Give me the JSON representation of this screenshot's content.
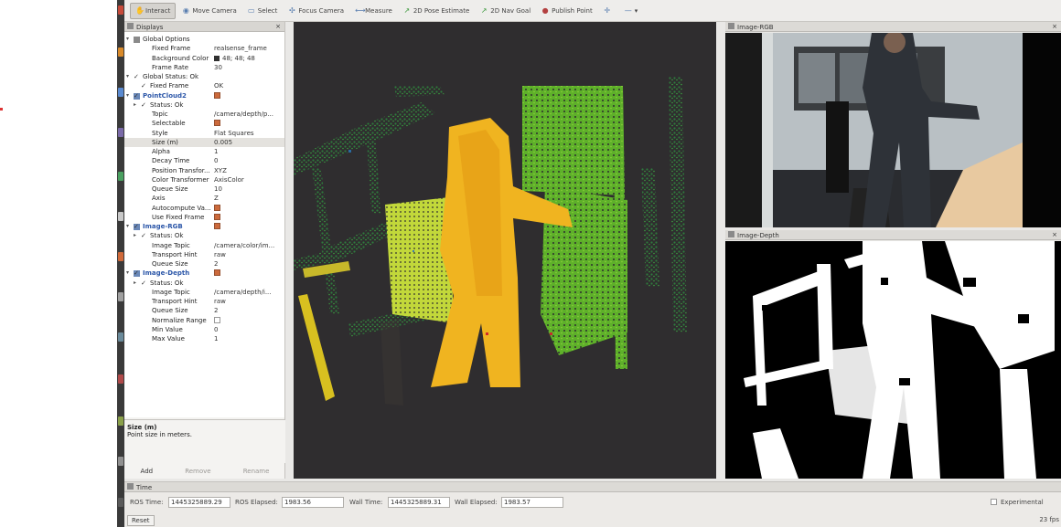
{
  "toolbar": {
    "tools": [
      {
        "label": "Interact",
        "icon": "hand-icon"
      },
      {
        "label": "Move Camera",
        "icon": "move-camera-icon"
      },
      {
        "label": "Select",
        "icon": "select-icon"
      },
      {
        "label": "Focus Camera",
        "icon": "focus-camera-icon"
      },
      {
        "label": "Measure",
        "icon": "ruler-icon"
      },
      {
        "label": "2D Pose Estimate",
        "icon": "pose-arrow-icon"
      },
      {
        "label": "2D Nav Goal",
        "icon": "nav-goal-icon"
      },
      {
        "label": "Publish Point",
        "icon": "pin-icon"
      }
    ]
  },
  "displays": {
    "title": "Displays",
    "rows": [
      {
        "key": "Global Options",
        "value": ""
      },
      {
        "key": "Fixed Frame",
        "value": "realsense_frame"
      },
      {
        "key": "Background Color",
        "value": "48; 48; 48"
      },
      {
        "key": "Frame Rate",
        "value": "30"
      },
      {
        "key": "Global Status: Ok",
        "value": ""
      },
      {
        "key": "Fixed Frame",
        "value": "OK"
      },
      {
        "key": "PointCloud2",
        "value": ""
      },
      {
        "key": "Status: Ok",
        "value": ""
      },
      {
        "key": "Topic",
        "value": "/camera/depth/p..."
      },
      {
        "key": "Selectable",
        "value": ""
      },
      {
        "key": "Style",
        "value": "Flat Squares"
      },
      {
        "key": "Size (m)",
        "value": "0.005"
      },
      {
        "key": "Alpha",
        "value": "1"
      },
      {
        "key": "Decay Time",
        "value": "0"
      },
      {
        "key": "Position Transfor...",
        "value": "XYZ"
      },
      {
        "key": "Color Transformer",
        "value": "AxisColor"
      },
      {
        "key": "Queue Size",
        "value": "10"
      },
      {
        "key": "Axis",
        "value": "Z"
      },
      {
        "key": "Autocompute Va...",
        "value": ""
      },
      {
        "key": "Use Fixed Frame",
        "value": ""
      },
      {
        "key": "Image-RGB",
        "value": ""
      },
      {
        "key": "Status: Ok",
        "value": ""
      },
      {
        "key": "Image Topic",
        "value": "/camera/color/im..."
      },
      {
        "key": "Transport Hint",
        "value": "raw"
      },
      {
        "key": "Queue Size",
        "value": "2"
      },
      {
        "key": "Image-Depth",
        "value": ""
      },
      {
        "key": "Status: Ok",
        "value": ""
      },
      {
        "key": "Image Topic",
        "value": "/camera/depth/i..."
      },
      {
        "key": "Transport Hint",
        "value": "raw"
      },
      {
        "key": "Queue Size",
        "value": "2"
      },
      {
        "key": "Normalize Range",
        "value": ""
      },
      {
        "key": "Min Value",
        "value": "0"
      },
      {
        "key": "Max Value",
        "value": "1"
      }
    ],
    "description_title": "Size (m)",
    "description_text": "Point size in meters.",
    "add_label": "Add",
    "remove_label": "Remove",
    "rename_label": "Rename"
  },
  "image_rgb": {
    "title": "Image-RGB"
  },
  "image_depth": {
    "title": "Image-Depth"
  },
  "time": {
    "title": "Time",
    "ros_time_label": "ROS Time:",
    "ros_time": "1445325889.29",
    "ros_elapsed_label": "ROS Elapsed:",
    "ros_elapsed": "1983.56",
    "wall_time_label": "Wall Time:",
    "wall_time": "1445325889.31",
    "wall_elapsed_label": "Wall Elapsed:",
    "wall_elapsed": "1983.57",
    "experimental_label": "Experimental",
    "reset_label": "Reset",
    "fps": "23 fps"
  },
  "colors": {
    "cloud_yellow": "#f0b820",
    "cloud_lime": "#c8dc3a",
    "cloud_green": "#6ebe2a",
    "view_bg": "#2f2d2f"
  }
}
